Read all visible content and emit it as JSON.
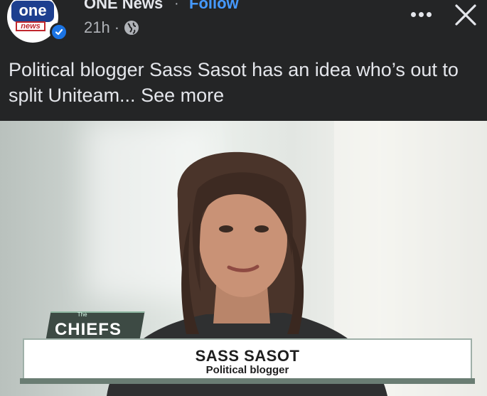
{
  "post": {
    "page_name": "ONE News",
    "separator": "·",
    "follow_label": "Follow",
    "time": "21h",
    "time_separator": "·",
    "visibility_icon": "globe-icon",
    "avatar": {
      "logo_top": "one",
      "logo_bottom": "news"
    },
    "caption": "Political blogger Sass Sasot has an idea who’s out to split Uniteam...",
    "see_more_label": "See more",
    "more_icon": "more-dots-icon",
    "close_icon": "close-icon"
  },
  "video": {
    "show_small": "The",
    "show_name": "CHIEFS",
    "guest_name": "SASS SASOT",
    "guest_role": "Political blogger"
  },
  "colors": {
    "background": "#242526",
    "follow_link": "#4599ff",
    "verified_badge": "#1b74e4",
    "logo_blue": "#1d3f8f",
    "logo_red": "#c0272d"
  }
}
